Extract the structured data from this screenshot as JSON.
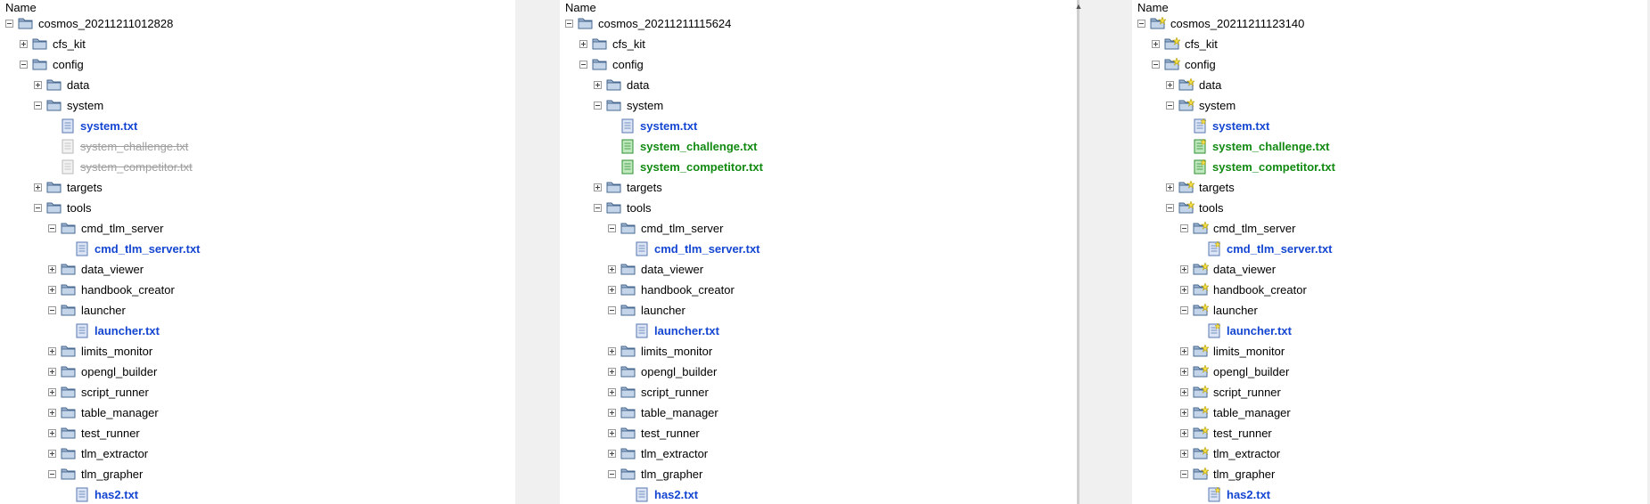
{
  "header": "Name",
  "colors": {
    "blue": "#1446d2",
    "green": "#128a12",
    "deleted": "#a0a0a0"
  },
  "panes": [
    {
      "root": "cosmos_20211211012828",
      "rows": [
        {
          "label": "cosmos_20211211012828",
          "level": 0,
          "type": "folder",
          "exp": "minus",
          "style": "normal"
        },
        {
          "label": "cfs_kit",
          "level": 1,
          "type": "folder",
          "exp": "plus",
          "style": "normal"
        },
        {
          "label": "config",
          "level": 1,
          "type": "folder",
          "exp": "minus",
          "style": "normal"
        },
        {
          "label": "data",
          "level": 2,
          "type": "folder",
          "exp": "plus",
          "style": "normal"
        },
        {
          "label": "system",
          "level": 2,
          "type": "folder",
          "exp": "minus",
          "style": "normal"
        },
        {
          "label": "system.txt",
          "level": 3,
          "type": "file",
          "file": "blue",
          "style": "blue"
        },
        {
          "label": "system_challenge.txt",
          "level": 3,
          "type": "file",
          "file": "gray",
          "style": "deleted"
        },
        {
          "label": "system_competitor.txt",
          "level": 3,
          "type": "file",
          "file": "gray",
          "style": "deleted"
        },
        {
          "label": "targets",
          "level": 2,
          "type": "folder",
          "exp": "plus",
          "style": "normal"
        },
        {
          "label": "tools",
          "level": 2,
          "type": "folder",
          "exp": "minus",
          "style": "normal"
        },
        {
          "label": "cmd_tlm_server",
          "level": 3,
          "type": "folder",
          "exp": "minus",
          "style": "normal"
        },
        {
          "label": "cmd_tlm_server.txt",
          "level": 4,
          "type": "file",
          "file": "blue",
          "style": "blue"
        },
        {
          "label": "data_viewer",
          "level": 3,
          "type": "folder",
          "exp": "plus",
          "style": "normal"
        },
        {
          "label": "handbook_creator",
          "level": 3,
          "type": "folder",
          "exp": "plus",
          "style": "normal"
        },
        {
          "label": "launcher",
          "level": 3,
          "type": "folder",
          "exp": "minus",
          "style": "normal"
        },
        {
          "label": "launcher.txt",
          "level": 4,
          "type": "file",
          "file": "blue",
          "style": "blue"
        },
        {
          "label": "limits_monitor",
          "level": 3,
          "type": "folder",
          "exp": "plus",
          "style": "normal"
        },
        {
          "label": "opengl_builder",
          "level": 3,
          "type": "folder",
          "exp": "plus",
          "style": "normal"
        },
        {
          "label": "script_runner",
          "level": 3,
          "type": "folder",
          "exp": "plus",
          "style": "normal"
        },
        {
          "label": "table_manager",
          "level": 3,
          "type": "folder",
          "exp": "plus",
          "style": "normal"
        },
        {
          "label": "test_runner",
          "level": 3,
          "type": "folder",
          "exp": "plus",
          "style": "normal"
        },
        {
          "label": "tlm_extractor",
          "level": 3,
          "type": "folder",
          "exp": "plus",
          "style": "normal"
        },
        {
          "label": "tlm_grapher",
          "level": 3,
          "type": "folder",
          "exp": "minus",
          "style": "normal"
        },
        {
          "label": "has2.txt",
          "level": 4,
          "type": "file",
          "file": "blue",
          "style": "blue"
        }
      ]
    },
    {
      "root": "cosmos_20211211115624",
      "rows": [
        {
          "label": "cosmos_20211211115624",
          "level": 0,
          "type": "folder",
          "exp": "minus",
          "style": "normal"
        },
        {
          "label": "cfs_kit",
          "level": 1,
          "type": "folder",
          "exp": "plus",
          "style": "normal"
        },
        {
          "label": "config",
          "level": 1,
          "type": "folder",
          "exp": "minus",
          "style": "normal"
        },
        {
          "label": "data",
          "level": 2,
          "type": "folder",
          "exp": "plus",
          "style": "normal"
        },
        {
          "label": "system",
          "level": 2,
          "type": "folder",
          "exp": "minus",
          "style": "normal"
        },
        {
          "label": "system.txt",
          "level": 3,
          "type": "file",
          "file": "blue",
          "style": "blue"
        },
        {
          "label": "system_challenge.txt",
          "level": 3,
          "type": "file",
          "file": "green",
          "style": "green"
        },
        {
          "label": "system_competitor.txt",
          "level": 3,
          "type": "file",
          "file": "green",
          "style": "green"
        },
        {
          "label": "targets",
          "level": 2,
          "type": "folder",
          "exp": "plus",
          "style": "normal"
        },
        {
          "label": "tools",
          "level": 2,
          "type": "folder",
          "exp": "minus",
          "style": "normal"
        },
        {
          "label": "cmd_tlm_server",
          "level": 3,
          "type": "folder",
          "exp": "minus",
          "style": "normal"
        },
        {
          "label": "cmd_tlm_server.txt",
          "level": 4,
          "type": "file",
          "file": "blue",
          "style": "blue"
        },
        {
          "label": "data_viewer",
          "level": 3,
          "type": "folder",
          "exp": "plus",
          "style": "normal"
        },
        {
          "label": "handbook_creator",
          "level": 3,
          "type": "folder",
          "exp": "plus",
          "style": "normal"
        },
        {
          "label": "launcher",
          "level": 3,
          "type": "folder",
          "exp": "minus",
          "style": "normal"
        },
        {
          "label": "launcher.txt",
          "level": 4,
          "type": "file",
          "file": "blue",
          "style": "blue"
        },
        {
          "label": "limits_monitor",
          "level": 3,
          "type": "folder",
          "exp": "plus",
          "style": "normal"
        },
        {
          "label": "opengl_builder",
          "level": 3,
          "type": "folder",
          "exp": "plus",
          "style": "normal"
        },
        {
          "label": "script_runner",
          "level": 3,
          "type": "folder",
          "exp": "plus",
          "style": "normal"
        },
        {
          "label": "table_manager",
          "level": 3,
          "type": "folder",
          "exp": "plus",
          "style": "normal"
        },
        {
          "label": "test_runner",
          "level": 3,
          "type": "folder",
          "exp": "plus",
          "style": "normal"
        },
        {
          "label": "tlm_extractor",
          "level": 3,
          "type": "folder",
          "exp": "plus",
          "style": "normal"
        },
        {
          "label": "tlm_grapher",
          "level": 3,
          "type": "folder",
          "exp": "minus",
          "style": "normal"
        },
        {
          "label": "has2.txt",
          "level": 4,
          "type": "file",
          "file": "blue",
          "style": "blue"
        }
      ]
    },
    {
      "root": "cosmos_20211211123140",
      "rows": [
        {
          "label": "cosmos_20211211123140",
          "level": 0,
          "type": "folder",
          "exp": "minus",
          "style": "normal",
          "star": true
        },
        {
          "label": "cfs_kit",
          "level": 1,
          "type": "folder",
          "exp": "plus",
          "style": "normal",
          "star": true
        },
        {
          "label": "config",
          "level": 1,
          "type": "folder",
          "exp": "minus",
          "style": "normal",
          "star": true
        },
        {
          "label": "data",
          "level": 2,
          "type": "folder",
          "exp": "plus",
          "style": "normal",
          "star": true
        },
        {
          "label": "system",
          "level": 2,
          "type": "folder",
          "exp": "minus",
          "style": "normal",
          "star": true
        },
        {
          "label": "system.txt",
          "level": 3,
          "type": "file",
          "file": "blue",
          "style": "blue",
          "star": true
        },
        {
          "label": "system_challenge.txt",
          "level": 3,
          "type": "file",
          "file": "green",
          "style": "green",
          "star": true
        },
        {
          "label": "system_competitor.txt",
          "level": 3,
          "type": "file",
          "file": "green",
          "style": "green",
          "star": true
        },
        {
          "label": "targets",
          "level": 2,
          "type": "folder",
          "exp": "plus",
          "style": "normal",
          "star": true
        },
        {
          "label": "tools",
          "level": 2,
          "type": "folder",
          "exp": "minus",
          "style": "normal",
          "star": true
        },
        {
          "label": "cmd_tlm_server",
          "level": 3,
          "type": "folder",
          "exp": "minus",
          "style": "normal",
          "star": true
        },
        {
          "label": "cmd_tlm_server.txt",
          "level": 4,
          "type": "file",
          "file": "blue",
          "style": "blue",
          "star": true
        },
        {
          "label": "data_viewer",
          "level": 3,
          "type": "folder",
          "exp": "plus",
          "style": "normal",
          "star": true
        },
        {
          "label": "handbook_creator",
          "level": 3,
          "type": "folder",
          "exp": "plus",
          "style": "normal",
          "star": true
        },
        {
          "label": "launcher",
          "level": 3,
          "type": "folder",
          "exp": "minus",
          "style": "normal",
          "star": true
        },
        {
          "label": "launcher.txt",
          "level": 4,
          "type": "file",
          "file": "blue",
          "style": "blue",
          "star": true
        },
        {
          "label": "limits_monitor",
          "level": 3,
          "type": "folder",
          "exp": "plus",
          "style": "normal",
          "star": true
        },
        {
          "label": "opengl_builder",
          "level": 3,
          "type": "folder",
          "exp": "plus",
          "style": "normal",
          "star": true
        },
        {
          "label": "script_runner",
          "level": 3,
          "type": "folder",
          "exp": "plus",
          "style": "normal",
          "star": true
        },
        {
          "label": "table_manager",
          "level": 3,
          "type": "folder",
          "exp": "plus",
          "style": "normal",
          "star": true
        },
        {
          "label": "test_runner",
          "level": 3,
          "type": "folder",
          "exp": "plus",
          "style": "normal",
          "star": true
        },
        {
          "label": "tlm_extractor",
          "level": 3,
          "type": "folder",
          "exp": "plus",
          "style": "normal",
          "star": true
        },
        {
          "label": "tlm_grapher",
          "level": 3,
          "type": "folder",
          "exp": "minus",
          "style": "normal",
          "star": true
        },
        {
          "label": "has2.txt",
          "level": 4,
          "type": "file",
          "file": "blue",
          "style": "blue",
          "star": true
        }
      ]
    }
  ]
}
